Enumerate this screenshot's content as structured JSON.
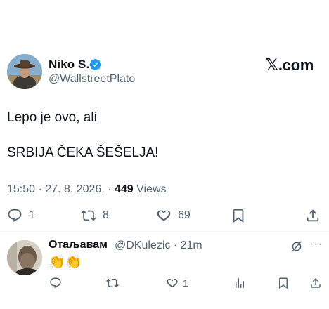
{
  "tweet": {
    "author_name": "Niko S.",
    "author_handle": "@WallstreetPlato",
    "verified": true,
    "source_label": "X.com",
    "text_line_1": "Lepo je ovo, ali",
    "text_line_2": "SRBIJA ČEKA ŠEŠELJA!",
    "timestamp": "15:50 · 27. 8. 2026. · ",
    "views_count": "449",
    "views_label": " Views",
    "replies": "1",
    "reposts": "8",
    "likes": "69"
  },
  "reply": {
    "author_name": "Отаљавам",
    "author_handle": "@DKulezic · 21m",
    "text": "👏👏",
    "replies": "",
    "reposts": "",
    "likes": "1"
  },
  "colors": {
    "text": "#0f1419",
    "secondary": "#536471",
    "verified_blue": "#1d9bf0",
    "divider": "#eff3f4"
  },
  "icons": [
    "reply-icon",
    "repost-icon",
    "like-icon",
    "bookmark-icon",
    "share-icon",
    "views-icon",
    "grok-icon",
    "more-icon",
    "verified-badge-icon"
  ]
}
